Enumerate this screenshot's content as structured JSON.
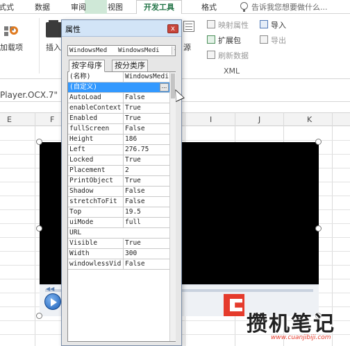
{
  "ribbon": {
    "tabs": [
      {
        "label": "式式"
      },
      {
        "label": "数据"
      },
      {
        "label": "审阅"
      },
      {
        "label": "视图"
      },
      {
        "label": "开发工具"
      },
      {
        "label": "格式"
      }
    ],
    "tell_me": "告诉我您想要做什么...",
    "addins_label": "加载项",
    "insert_label": "插入",
    "source_label": "源",
    "xml_buttons": {
      "map_properties": "映射属性",
      "expansion_packs": "扩展包",
      "refresh_data": "刷新数据",
      "import": "导入",
      "export": "导出"
    },
    "xml_group": "XML"
  },
  "name_box": {
    "text": "Player.OCX.7\""
  },
  "columns": [
    "E",
    "F",
    "I",
    "J",
    "K"
  ],
  "properties_dialog": {
    "title": "属性",
    "close_glyph": "x",
    "object_name": "WindowsMed",
    "object_type": "WindowsMedi",
    "tabs": [
      "按字母序",
      "按分类序"
    ],
    "header_row": {
      "name": "(名称)",
      "value": "WindowsMedi"
    },
    "selected_row": {
      "name": "(自定义)",
      "value": ""
    },
    "ellipsis": "...",
    "rows": [
      {
        "name": "AutoLoad",
        "value": "False"
      },
      {
        "name": "enableContext",
        "value": "True"
      },
      {
        "name": "Enabled",
        "value": "True"
      },
      {
        "name": "fullScreen",
        "value": "False"
      },
      {
        "name": "Height",
        "value": "186"
      },
      {
        "name": "Left",
        "value": "276.75"
      },
      {
        "name": "Locked",
        "value": "True"
      },
      {
        "name": "Placement",
        "value": "2"
      },
      {
        "name": "PrintObject",
        "value": "True"
      },
      {
        "name": "Shadow",
        "value": "False"
      },
      {
        "name": "stretchToFit",
        "value": "False"
      },
      {
        "name": "Top",
        "value": "19.5"
      },
      {
        "name": "uiMode",
        "value": "full"
      },
      {
        "name": "URL",
        "value": ""
      },
      {
        "name": "Visible",
        "value": "True"
      },
      {
        "name": "Width",
        "value": "300"
      },
      {
        "name": "windowlessVid",
        "value": "False"
      }
    ]
  },
  "watermark": {
    "text": "攒机笔记",
    "url": "www.cuanjibiji.com"
  },
  "colors": {
    "accent_green": "#217346",
    "selection_blue": "#3399ff",
    "close_red": "#c8453b",
    "watermark_red": "#e53b2c"
  }
}
